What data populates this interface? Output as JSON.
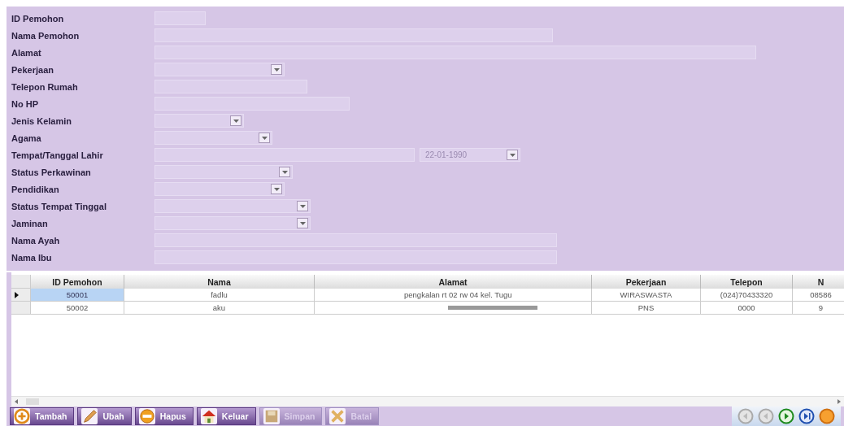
{
  "form": {
    "fields": [
      {
        "label": "ID Pemohon",
        "kind": "text"
      },
      {
        "label": "Nama Pemohon",
        "kind": "text"
      },
      {
        "label": "Alamat",
        "kind": "text"
      },
      {
        "label": "Pekerjaan",
        "kind": "combo"
      },
      {
        "label": "Telepon Rumah",
        "kind": "text"
      },
      {
        "label": "No HP",
        "kind": "text"
      },
      {
        "label": "Jenis Kelamin",
        "kind": "combo"
      },
      {
        "label": "Agama",
        "kind": "combo"
      },
      {
        "label": "Tempat/Tanggal Lahir",
        "kind": "textdate",
        "date": "22-01-1990"
      },
      {
        "label": "Status Perkawinan",
        "kind": "combo"
      },
      {
        "label": "Pendidikan",
        "kind": "combo"
      },
      {
        "label": "Status Tempat Tinggal",
        "kind": "combo"
      },
      {
        "label": "Jaminan",
        "kind": "combo"
      },
      {
        "label": "Nama Ayah",
        "kind": "text"
      },
      {
        "label": "Nama Ibu",
        "kind": "text"
      }
    ]
  },
  "table": {
    "columns": [
      "ID Pemohon",
      "Nama",
      "Alamat",
      "Pekerjaan",
      "Telepon",
      "N"
    ],
    "rows": [
      {
        "selected": true,
        "cells": [
          "50001",
          "fadlu",
          "pengkalan rt 02 rw 04 kel. Tugu",
          "WIRASWASTA",
          "(024)70433320",
          "08586"
        ]
      },
      {
        "selected": false,
        "cells": [
          "50002",
          "aku",
          "",
          "PNS",
          "0000",
          "9"
        ]
      }
    ]
  },
  "toolbar": [
    {
      "label": "Tambah",
      "kind": "add",
      "disabled": false
    },
    {
      "label": "Ubah",
      "kind": "edit",
      "disabled": false
    },
    {
      "label": "Hapus",
      "kind": "delete",
      "disabled": false
    },
    {
      "label": "Keluar",
      "kind": "exit",
      "disabled": false
    },
    {
      "label": "Simpan",
      "kind": "save",
      "disabled": true
    },
    {
      "label": "Batal",
      "kind": "cancel",
      "disabled": true
    }
  ],
  "navigation": [
    {
      "kind": "first",
      "disabled": true
    },
    {
      "kind": "prev",
      "disabled": true
    },
    {
      "kind": "next",
      "disabled": false
    },
    {
      "kind": "last",
      "disabled": false
    },
    {
      "kind": "extra",
      "disabled": false
    }
  ]
}
